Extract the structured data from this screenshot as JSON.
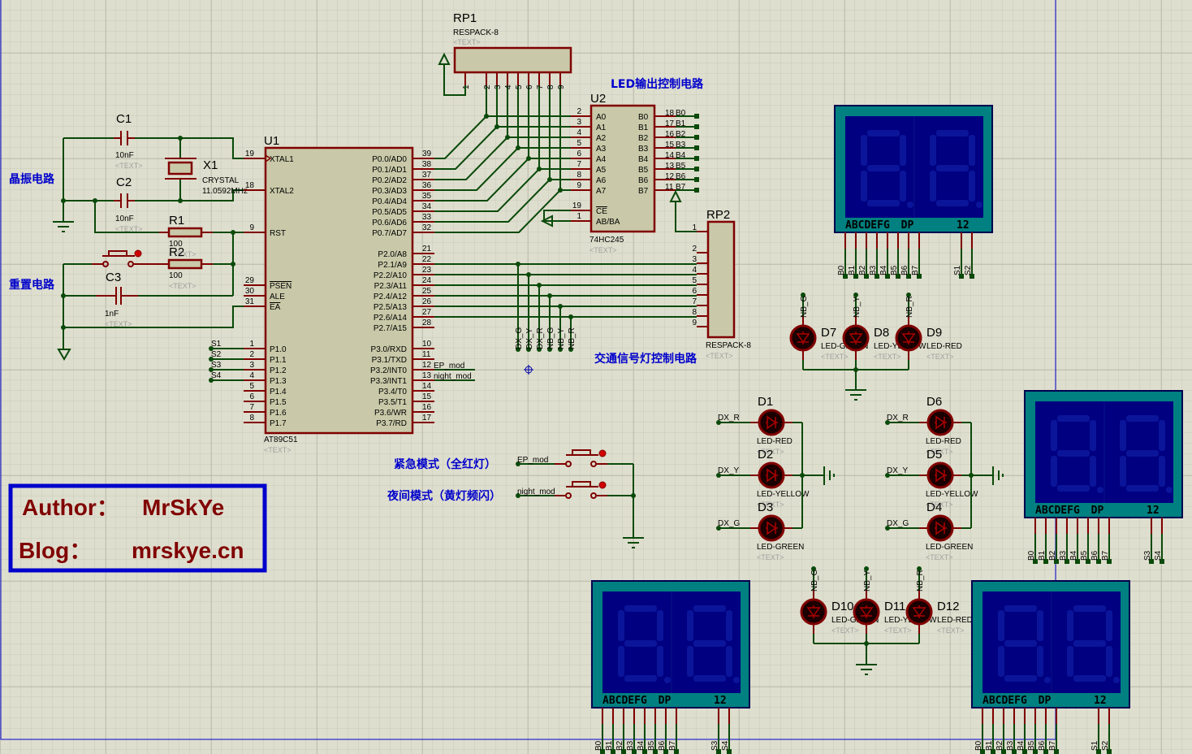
{
  "colors": {
    "background": "#dedece",
    "wire": "#0a4a0a",
    "pin": "#800000",
    "component_fill": "#c9c9a9",
    "display_frame": "#008080",
    "display_face": "#000080",
    "label_blue": "#0000cc",
    "author_text": "#800000",
    "sheet_border": "#0000cc"
  },
  "labels": {
    "crystal_circuit": "晶振电路",
    "reset_circuit": "重置电路",
    "led_output": "LED输出控制电路",
    "traffic_light": "交通信号灯控制电路",
    "emergency_mode": "紧急模式（全红灯）",
    "night_mode": "夜间模式（黄灯频闪）"
  },
  "author_box": {
    "author_label": "Author：",
    "author": "MrSkYe",
    "blog_label": "Blog：",
    "blog": "mrskye.cn"
  },
  "placeholder": "<TEXT>",
  "passives": {
    "c1": {
      "ref": "C1",
      "value": "10nF"
    },
    "c2": {
      "ref": "C2",
      "value": "10nF"
    },
    "c3": {
      "ref": "C3",
      "value": "1nF"
    },
    "x1": {
      "ref": "X1",
      "part": "CRYSTAL",
      "value": "11.0592MHz"
    },
    "r1": {
      "ref": "R1",
      "value": "100"
    },
    "r2": {
      "ref": "R2",
      "value": "100"
    }
  },
  "u1": {
    "ref": "U1",
    "part": "AT89C51",
    "left_pins": [
      {
        "num": "19",
        "name": "XTAL1"
      },
      {
        "num": "18",
        "name": "XTAL2"
      },
      {
        "num": "9",
        "name": "RST"
      },
      {
        "num": "29",
        "name": "PSEN"
      },
      {
        "num": "30",
        "name": "ALE"
      },
      {
        "num": "31",
        "name": "EA"
      },
      {
        "num": "1",
        "name": "P1.0"
      },
      {
        "num": "2",
        "name": "P1.1"
      },
      {
        "num": "3",
        "name": "P1.2"
      },
      {
        "num": "4",
        "name": "P1.3"
      },
      {
        "num": "5",
        "name": "P1.4"
      },
      {
        "num": "6",
        "name": "P1.5"
      },
      {
        "num": "7",
        "name": "P1.6"
      },
      {
        "num": "8",
        "name": "P1.7"
      }
    ],
    "right_pins": [
      {
        "num": "39",
        "name": "P0.0/AD0"
      },
      {
        "num": "38",
        "name": "P0.1/AD1"
      },
      {
        "num": "37",
        "name": "P0.2/AD2"
      },
      {
        "num": "36",
        "name": "P0.3/AD3"
      },
      {
        "num": "35",
        "name": "P0.4/AD4"
      },
      {
        "num": "34",
        "name": "P0.5/AD5"
      },
      {
        "num": "33",
        "name": "P0.6/AD6"
      },
      {
        "num": "32",
        "name": "P0.7/AD7"
      },
      {
        "num": "21",
        "name": "P2.0/A8"
      },
      {
        "num": "22",
        "name": "P2.1/A9"
      },
      {
        "num": "23",
        "name": "P2.2/A10"
      },
      {
        "num": "24",
        "name": "P2.3/A11"
      },
      {
        "num": "25",
        "name": "P2.4/A12"
      },
      {
        "num": "26",
        "name": "P2.5/A13"
      },
      {
        "num": "27",
        "name": "P2.6/A14"
      },
      {
        "num": "28",
        "name": "P2.7/A15"
      },
      {
        "num": "10",
        "name": "P3.0/RXD"
      },
      {
        "num": "11",
        "name": "P3.1/TXD"
      },
      {
        "num": "12",
        "name": "P3.2/INT0"
      },
      {
        "num": "13",
        "name": "P3.3/INT1"
      },
      {
        "num": "14",
        "name": "P3.4/T0"
      },
      {
        "num": "15",
        "name": "P3.5/T1"
      },
      {
        "num": "16",
        "name": "P3.6/WR"
      },
      {
        "num": "17",
        "name": "P3.7/RD"
      }
    ],
    "p1_nets": [
      "S1",
      "S2",
      "S3",
      "S4"
    ],
    "p3_nets": [
      "EP_mod",
      "night_mod"
    ]
  },
  "u2": {
    "ref": "U2",
    "part": "74HC245",
    "left_pins": [
      {
        "num": "2",
        "name": "A0"
      },
      {
        "num": "3",
        "name": "A1"
      },
      {
        "num": "4",
        "name": "A2"
      },
      {
        "num": "5",
        "name": "A3"
      },
      {
        "num": "6",
        "name": "A4"
      },
      {
        "num": "7",
        "name": "A5"
      },
      {
        "num": "8",
        "name": "A6"
      },
      {
        "num": "9",
        "name": "A7"
      },
      {
        "num": "19",
        "name": "CE"
      },
      {
        "num": "1",
        "name": "AB/BA"
      }
    ],
    "right_pins": [
      {
        "num": "18",
        "name": "B0"
      },
      {
        "num": "17",
        "name": "B1"
      },
      {
        "num": "16",
        "name": "B2"
      },
      {
        "num": "15",
        "name": "B3"
      },
      {
        "num": "14",
        "name": "B4"
      },
      {
        "num": "13",
        "name": "B5"
      },
      {
        "num": "12",
        "name": "B6"
      },
      {
        "num": "11",
        "name": "B7"
      }
    ]
  },
  "rp1": {
    "ref": "RP1",
    "part": "RESPACK-8",
    "pins": [
      "1",
      "2",
      "3",
      "4",
      "5",
      "6",
      "7",
      "8",
      "9"
    ]
  },
  "rp2": {
    "ref": "RP2",
    "part": "RESPACK-8",
    "pins": [
      "1",
      "2",
      "3",
      "4",
      "5",
      "6",
      "7",
      "8",
      "9"
    ]
  },
  "p2_nets": [
    "DX_G",
    "DX_Y",
    "DX_R",
    "NB_G",
    "NB_Y",
    "NB_R"
  ],
  "switch_nets": [
    "EP_mod",
    "night_mod"
  ],
  "led_groups": [
    {
      "nets": [
        "NB_G",
        "NB_Y",
        "NB_R"
      ],
      "leds": [
        {
          "ref": "D7",
          "part": "LED-GREEN"
        },
        {
          "ref": "D8",
          "part": "LED-YELLOW"
        },
        {
          "ref": "D9",
          "part": "LED-RED"
        }
      ]
    },
    {
      "nets": [
        "NB_G",
        "NB_Y",
        "NB_R"
      ],
      "leds": [
        {
          "ref": "D10",
          "part": "LED-GREEN"
        },
        {
          "ref": "D11",
          "part": "LED-YELLOW"
        },
        {
          "ref": "D12",
          "part": "LED-RED"
        }
      ]
    },
    {
      "nets": [
        "DX_R",
        "DX_Y",
        "DX_G"
      ],
      "leds": [
        {
          "ref": "D1",
          "part": "LED-RED"
        },
        {
          "ref": "D2",
          "part": "LED-YELLOW"
        },
        {
          "ref": "D3",
          "part": "LED-GREEN"
        }
      ]
    },
    {
      "nets": [
        "DX_R",
        "DX_Y",
        "DX_G"
      ],
      "leds": [
        {
          "ref": "D6",
          "part": "LED-RED"
        },
        {
          "ref": "D5",
          "part": "LED-YELLOW"
        },
        {
          "ref": "D4",
          "part": "LED-GREEN"
        }
      ]
    }
  ],
  "displays": [
    {
      "segment_label": "ABCDEFG DP",
      "digit_label": "12",
      "pins": [
        "B0",
        "B1",
        "B2",
        "B3",
        "B4",
        "B5",
        "B6",
        "B7",
        "S1",
        "S2"
      ]
    },
    {
      "segment_label": "ABCDEFG DP",
      "digit_label": "12",
      "pins": [
        "B0",
        "B1",
        "B2",
        "B3",
        "B4",
        "B5",
        "B6",
        "B7",
        "S3",
        "S4"
      ]
    },
    {
      "segment_label": "ABCDEFG DP",
      "digit_label": "12",
      "pins": [
        "B0",
        "B1",
        "B2",
        "B3",
        "B4",
        "B5",
        "B6",
        "B7",
        "S3",
        "S4"
      ]
    },
    {
      "segment_label": "ABCDEFG DP",
      "digit_label": "12",
      "pins": [
        "B0",
        "B1",
        "B2",
        "B3",
        "B4",
        "B5",
        "B6",
        "B7",
        "S1",
        "S2"
      ]
    }
  ]
}
